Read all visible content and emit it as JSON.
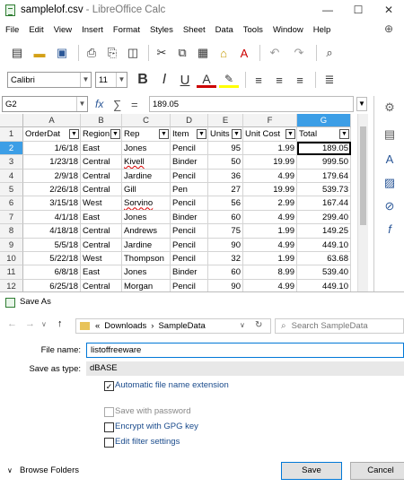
{
  "window": {
    "filename": "samplelof.csv",
    "app_suffix": "- LibreOffice Calc",
    "min": "—",
    "max": "☐",
    "close": "✕"
  },
  "menu": [
    "File",
    "Edit",
    "View",
    "Insert",
    "Format",
    "Styles",
    "Sheet",
    "Data",
    "Tools",
    "Window",
    "Help"
  ],
  "toolbar": {
    "font_name": "Calibri",
    "font_size": "11"
  },
  "formula": {
    "cell_ref": "G2",
    "content": "189.05",
    "fx": "fx",
    "sum": "∑",
    "eq": "="
  },
  "columns": [
    "A",
    "B",
    "C",
    "D",
    "E",
    "F",
    "G"
  ],
  "headers": [
    "OrderDat",
    "Region",
    "Rep",
    "Item",
    "Units",
    "Unit Cost",
    "Total"
  ],
  "row_numbers": [
    "1",
    "2",
    "3",
    "4",
    "5",
    "6",
    "7",
    "8",
    "9",
    "10",
    "11",
    "12"
  ],
  "rows": [
    [
      "1/6/18",
      "East",
      "Jones",
      "Pencil",
      "95",
      "1.99",
      "189.05"
    ],
    [
      "1/23/18",
      "Central",
      "Kivell",
      "Binder",
      "50",
      "19.99",
      "999.50"
    ],
    [
      "2/9/18",
      "Central",
      "Jardine",
      "Pencil",
      "36",
      "4.99",
      "179.64"
    ],
    [
      "2/26/18",
      "Central",
      "Gill",
      "Pen",
      "27",
      "19.99",
      "539.73"
    ],
    [
      "3/15/18",
      "West",
      "Sorvino",
      "Pencil",
      "56",
      "2.99",
      "167.44"
    ],
    [
      "4/1/18",
      "East",
      "Jones",
      "Binder",
      "60",
      "4.99",
      "299.40"
    ],
    [
      "4/18/18",
      "Central",
      "Andrews",
      "Pencil",
      "75",
      "1.99",
      "149.25"
    ],
    [
      "5/5/18",
      "Central",
      "Jardine",
      "Pencil",
      "90",
      "4.99",
      "449.10"
    ],
    [
      "5/22/18",
      "West",
      "Thompson",
      "Pencil",
      "32",
      "1.99",
      "63.68"
    ],
    [
      "6/8/18",
      "East",
      "Jones",
      "Binder",
      "60",
      "8.99",
      "539.40"
    ],
    [
      "6/25/18",
      "Central",
      "Morgan",
      "Pencil",
      "90",
      "4.99",
      "449.10"
    ]
  ],
  "dialog": {
    "title": "Save As",
    "path_prefix": "«",
    "path_folder1": "Downloads",
    "path_sep": "›",
    "path_folder2": "SampleData",
    "search_placeholder": "Search SampleData",
    "filename_label": "File name:",
    "filename_value": "listoffreeware",
    "type_label": "Save as type:",
    "type_value": "dBASE",
    "opt_auto_ext": "Automatic file name extension",
    "opt_password": "Save with password",
    "opt_encrypt": "Encrypt with GPG key",
    "opt_filter": "Edit filter settings",
    "browse_folders": "Browse Folders",
    "save": "Save",
    "cancel": "Cancel"
  },
  "colors": {
    "accent": "#0078d7",
    "selected_col": "#3c9ee6",
    "calc_green": "#2f7d32"
  }
}
